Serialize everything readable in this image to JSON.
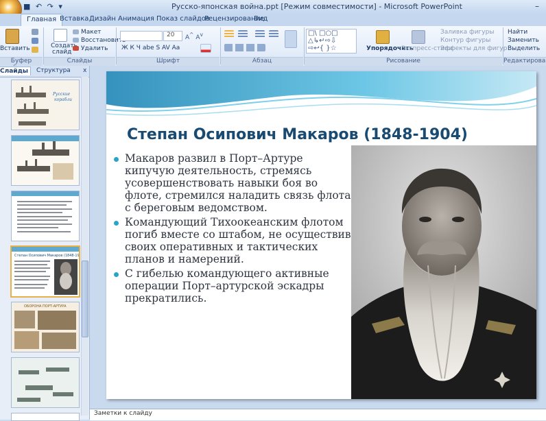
{
  "window": {
    "title": "Русско-японская война.ppt [Режим совместимости] - Microsoft PowerPoint",
    "qat": "■ ↶ ↷ ▾",
    "controls": "–"
  },
  "tabs": [
    "Главная",
    "Вставка",
    "Дизайн",
    "Анимация",
    "Показ слайдов",
    "Рецензирование",
    "Вид"
  ],
  "ribbon": {
    "paste": "Вставить",
    "clipboard": "Буфер обмена",
    "create_slide_1": "Создать",
    "create_slide_2": "слайд",
    "layout": "Макет",
    "reset": "Восстановить",
    "delete": "Удалить",
    "slides": "Слайды",
    "font_size": "20",
    "font": "Шрифт",
    "paragraph": "Абзац",
    "arrange": "Упорядочить",
    "quick_styles": "Экспресс-стили",
    "shape_fill": "Заливка фигуры",
    "shape_outline": "Контур фигуры",
    "shape_effects": "Эффекты для фигур",
    "drawing": "Рисование",
    "find": "Найти",
    "replace": "Заменить",
    "select": "Выделить",
    "editing": "Редактирование",
    "format_buttons": "Ж  К  Ч  abe  S  AV  Aa"
  },
  "panel": {
    "tab_slides": "Слайды",
    "tab_outline": "Структура",
    "close": "x"
  },
  "slide": {
    "title": "Степан Осипович Макаров (1848-1904)",
    "bullets": [
      "Макаров развил в Порт–Артуре кипучую деятельность, стремясь усовершенствовать навыки боя во флоте, стремился наладить связь флота с береговым ведомством.",
      "Командующий Тихоокеанским флотом погиб вместе со штабом, не осуществив своих оперативных и тактических планов и намерений.",
      "С гибелью командующего активные операции Порт–артурской эскадры прекратились."
    ]
  },
  "notes": {
    "placeholder": "Заметки к слайду"
  },
  "colors": {
    "title": "#184a72",
    "bullet": "#29a3c9",
    "wave": "#3a9bc4",
    "selected_thumb": "#e6b04a"
  }
}
